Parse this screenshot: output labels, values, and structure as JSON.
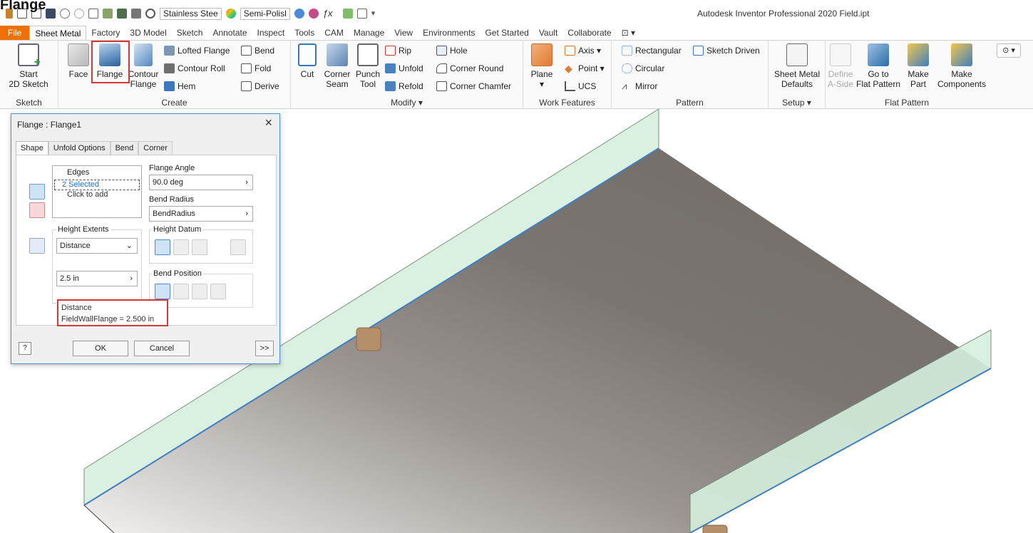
{
  "page_title": "Flange",
  "app_title": "Autodesk Inventor Professional 2020   Field.ipt",
  "qat": {
    "material": "Stainless Stee",
    "appearance": "Semi-Polisl"
  },
  "tabs": [
    "File",
    "Sheet Metal",
    "Factory",
    "3D Model",
    "Sketch",
    "Annotate",
    "Inspect",
    "Tools",
    "CAM",
    "Manage",
    "View",
    "Environments",
    "Get Started",
    "Vault",
    "Collaborate"
  ],
  "ribbon": {
    "sketch": {
      "start": "Start",
      "start2": "2D Sketch",
      "label": "Sketch"
    },
    "create": {
      "face": "Face",
      "flange": "Flange",
      "contour": "Contour",
      "contour2": "Flange",
      "lofted": "Lofted Flange",
      "contour_roll": "Contour Roll",
      "hem": "Hem",
      "bend": "Bend",
      "fold": "Fold",
      "derive": "Derive",
      "label": "Create"
    },
    "modify": {
      "cut": "Cut",
      "corner": "Corner",
      "seam": "Seam",
      "punch": "Punch",
      "tool": "Tool",
      "rip": "Rip",
      "unfold": "Unfold",
      "refold": "Refold",
      "hole": "Hole",
      "corner_round": "Corner Round",
      "corner_chamfer": "Corner Chamfer",
      "label": "Modify ▾"
    },
    "work": {
      "plane": "Plane",
      "axis": "Axis ▾",
      "point": "Point ▾",
      "ucs": "UCS",
      "label": "Work Features"
    },
    "pattern": {
      "rect": "Rectangular",
      "sketch_driven": "Sketch Driven",
      "circular": "Circular",
      "mirror": "Mirror",
      "label": "Pattern"
    },
    "setup": {
      "defaults1": "Sheet Metal",
      "defaults2": "Defaults",
      "label": "Setup ▾"
    },
    "flat": {
      "define1": "Define",
      "define2": "A-Side",
      "goto1": "Go to",
      "goto2": "Flat Pattern",
      "make1": "Make",
      "make2": "Part",
      "comp1": "Make",
      "comp2": "Components",
      "label": "Flat Pattern"
    }
  },
  "dialog": {
    "title": "Flange : Flange1",
    "tabs": [
      "Shape",
      "Unfold Options",
      "Bend",
      "Corner"
    ],
    "edges_header": "Edges",
    "edges_selected": "2 Selected",
    "edges_add": "Click to add",
    "flange_angle_label": "Flange Angle",
    "flange_angle": "90.0 deg",
    "bend_radius_label": "Bend Radius",
    "bend_radius": "BendRadius",
    "height_extents_label": "Height Extents",
    "height_extents": "Distance",
    "height_datum_label": "Height Datum",
    "distance_value": "2.5 in",
    "bend_position_label": "Bend Position",
    "tooltip_line1": "Distance",
    "tooltip_line2": "FieldWallFlange = 2.500 in",
    "ok": "OK",
    "cancel": "Cancel",
    "more": ">>"
  },
  "colors": {
    "file_tab": "#ee7203",
    "highlight": "#d23a3a",
    "plate": "#7d7874",
    "flange": "#d6efdd",
    "glyph": "#b58e6a"
  }
}
